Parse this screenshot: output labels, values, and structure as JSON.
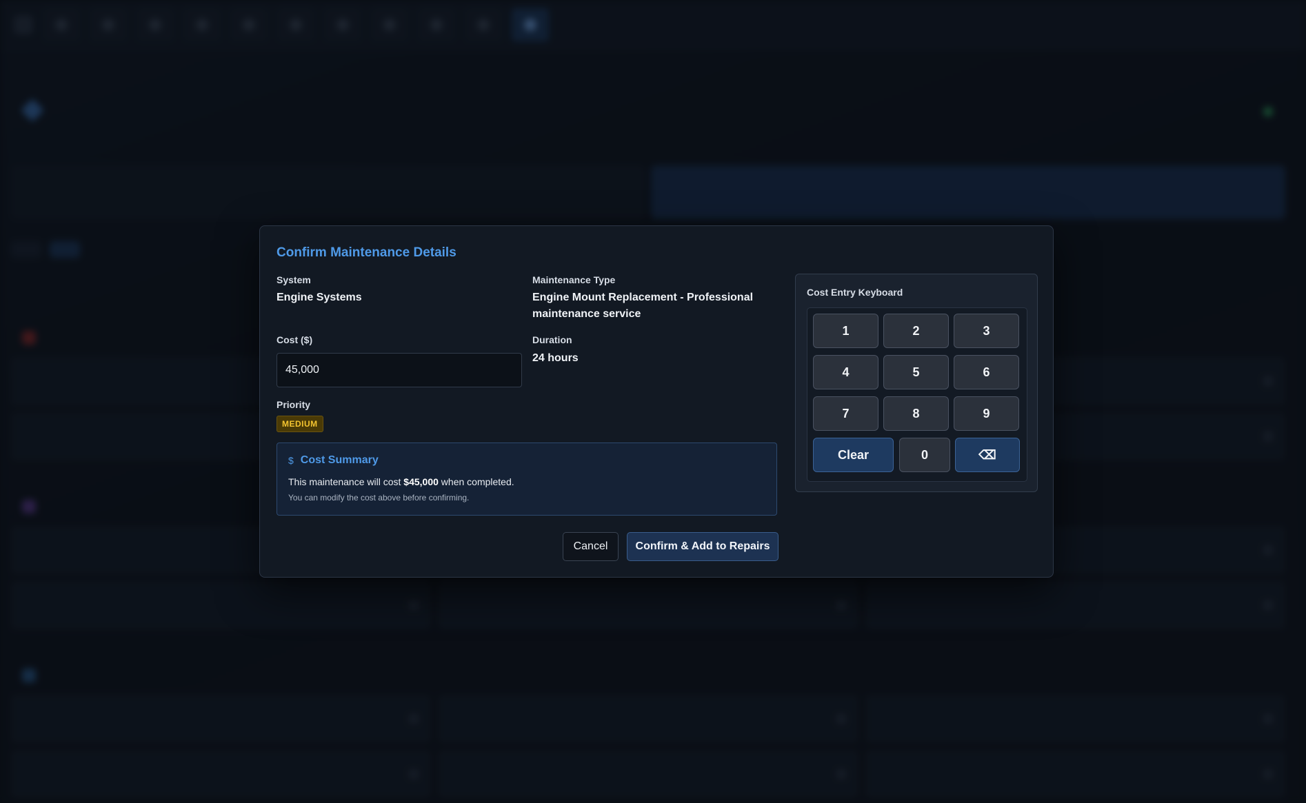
{
  "modal": {
    "title": "Confirm Maintenance Details",
    "system_label": "System",
    "system_value": "Engine Systems",
    "type_label": "Maintenance Type",
    "type_value": "Engine Mount Replacement - Professional maintenance service",
    "cost_label": "Cost ($)",
    "cost_value": "45,000",
    "duration_label": "Duration",
    "duration_value": "24 hours",
    "priority_label": "Priority",
    "priority_value": "MEDIUM",
    "summary": {
      "title": "Cost Summary",
      "icon": "$",
      "line_prefix": "This maintenance will cost ",
      "line_amount": "$45,000",
      "line_suffix": " when completed.",
      "note": "You can modify the cost above before confirming."
    },
    "cancel_label": "Cancel",
    "confirm_label": "Confirm & Add to Repairs"
  },
  "keypad": {
    "title": "Cost Entry Keyboard",
    "keys": [
      "1",
      "2",
      "3",
      "4",
      "5",
      "6",
      "7",
      "8",
      "9",
      "Clear",
      "0",
      "⌫"
    ]
  },
  "colors": {
    "accent": "#4f9ae8",
    "priority_medium_bg": "#4a3a06",
    "priority_medium_text": "#f4c430",
    "modal_bg": "#121923"
  }
}
